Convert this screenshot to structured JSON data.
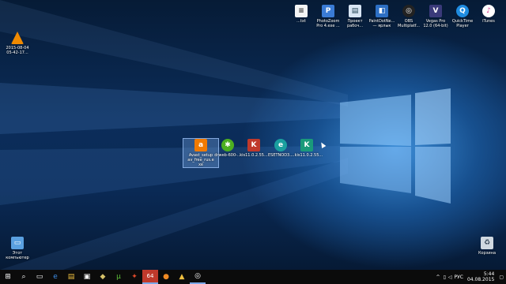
{
  "desktop": {
    "left_icons": [
      {
        "label": "2015-08-04\n05-42-17...",
        "icon": "vlc-icon"
      }
    ],
    "top_icons": [
      {
        "label": "...txt",
        "icon": "text-file-icon"
      },
      {
        "label": "PhotoZoom\nPro 4.exe ...",
        "icon": "photozoom-icon"
      },
      {
        "label": "Проект\nрабоч...",
        "icon": "project-icon"
      },
      {
        "label": "PaintDotNe...\n— ярлык",
        "icon": "paintdotnet-icon"
      },
      {
        "label": "OBS\nMultiplatf...",
        "icon": "obs-icon"
      },
      {
        "label": "Vegas Pro\n12.0 (64-bit)",
        "icon": "vegas-icon"
      },
      {
        "label": "QuickTime\nPlayer",
        "icon": "quicktime-icon"
      },
      {
        "label": "iTunes",
        "icon": "itunes-icon"
      }
    ],
    "middle_icons": [
      {
        "label": "Avast_setup\nav_free_rus.e\nxe",
        "icon": "avast-icon",
        "selected": true
      },
      {
        "label": "drweb-600-...",
        "icon": "drweb-icon"
      },
      {
        "label": "kis11.0.2.55...",
        "icon": "kaspersky-icon"
      },
      {
        "label": "ESETNOD3...",
        "icon": "eset-icon"
      },
      {
        "label": "...kis11.0.2.55...",
        "icon": "kaspersky-installer-icon"
      }
    ],
    "bottom_icons": [
      {
        "label": "Этот\nкомпьютер",
        "icon": "this-pc-icon"
      },
      {
        "label": "Корзина",
        "icon": "recycle-bin-icon"
      }
    ]
  },
  "taskbar": {
    "items": [
      {
        "name": "start-button",
        "glyph": "⊞"
      },
      {
        "name": "search-button",
        "glyph": "⌕"
      },
      {
        "name": "task-view-button",
        "glyph": "▭"
      },
      {
        "name": "edge-button",
        "glyph": "e"
      },
      {
        "name": "explorer-button",
        "glyph": "▤"
      },
      {
        "name": "store-button",
        "glyph": "▣"
      },
      {
        "name": "app-1-button",
        "glyph": "◆"
      },
      {
        "name": "torrent-button",
        "glyph": "µ"
      },
      {
        "name": "app-2-button",
        "glyph": "✦"
      },
      {
        "name": "app-3-button",
        "glyph": "64"
      },
      {
        "name": "firefox-button",
        "glyph": "●"
      },
      {
        "name": "app-4-button",
        "glyph": "▲"
      },
      {
        "name": "obs-taskbar-button",
        "glyph": "◎"
      }
    ],
    "tray": {
      "language": "РУС",
      "time": "5:44",
      "date": "04.08.2015"
    }
  },
  "colors": {
    "accent": "#3d8ed8",
    "taskbar": "#0b0b0b"
  }
}
